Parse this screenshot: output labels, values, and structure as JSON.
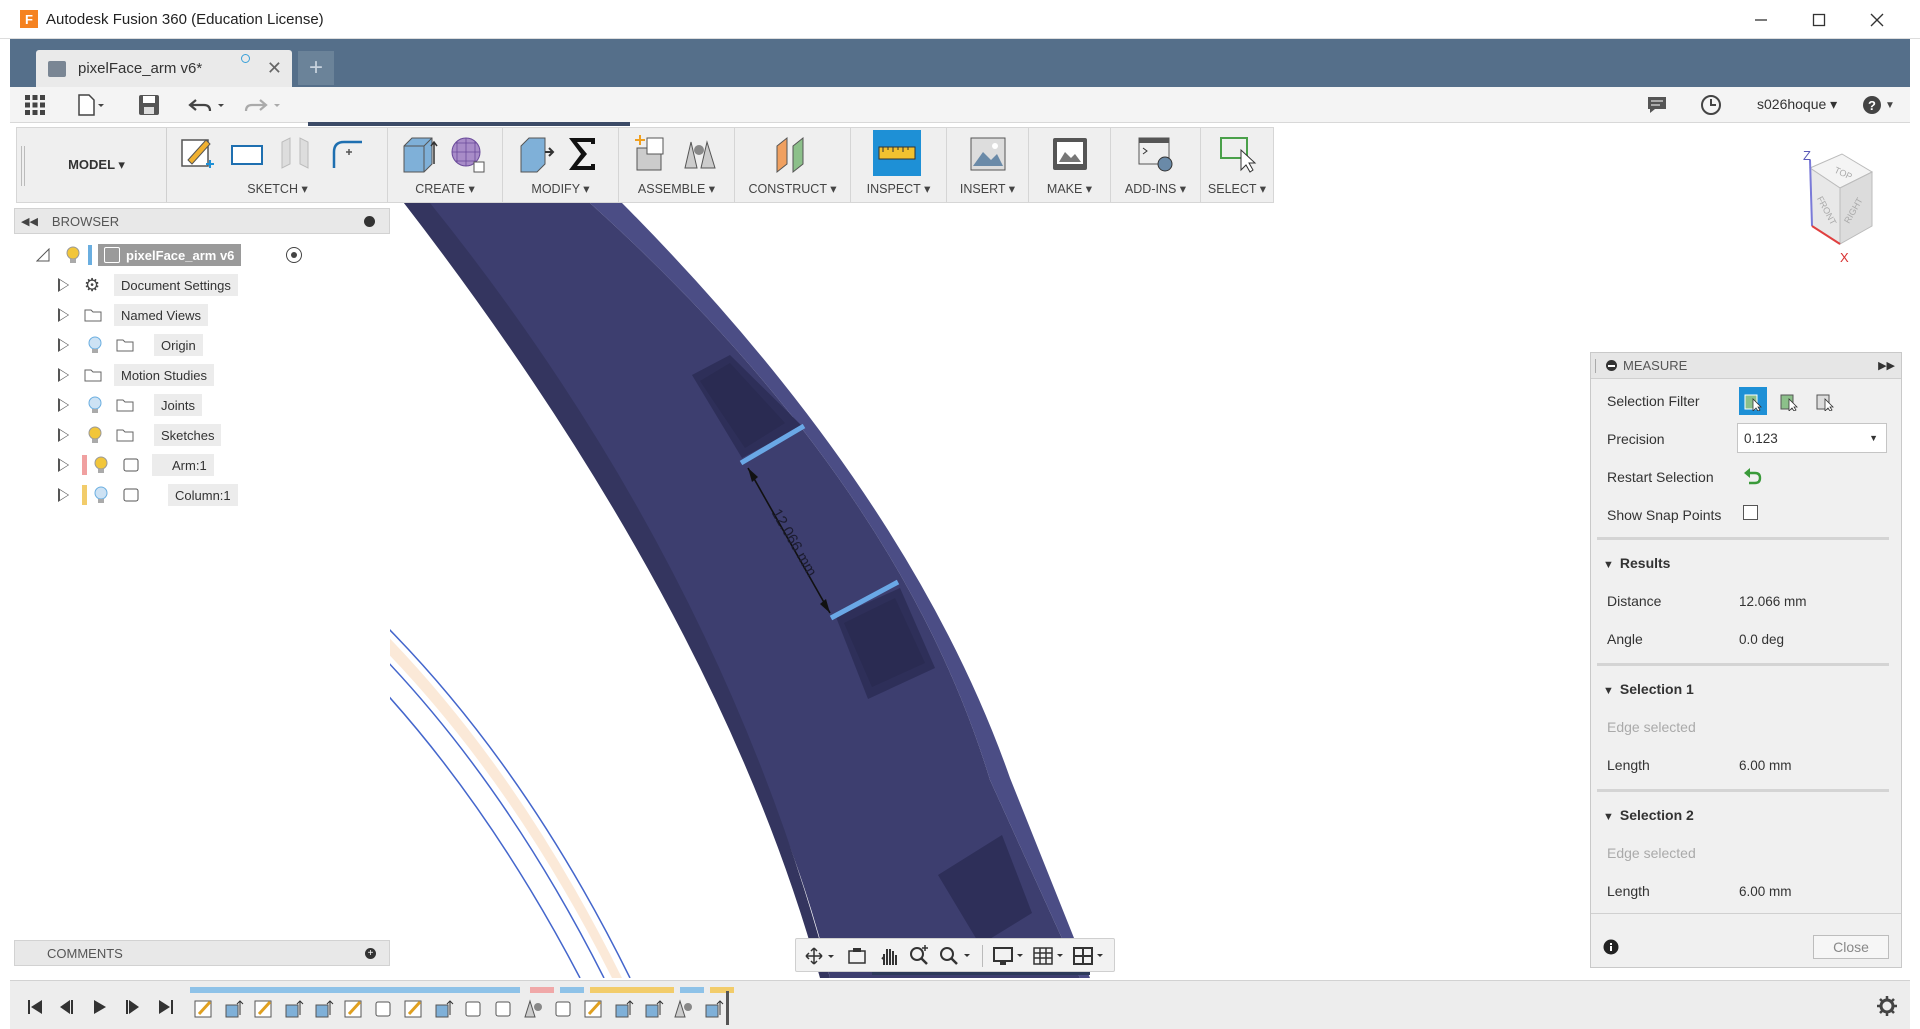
{
  "window": {
    "title": "Autodesk Fusion 360 (Education License)",
    "logo_letter": "F"
  },
  "tab": {
    "label": "pixelFace_arm v6*",
    "new_tab": "+"
  },
  "qat": {
    "user": "s026hoque ▾",
    "help": "? ▾"
  },
  "ribbon": {
    "workspace": "MODEL ▾",
    "groups": [
      "SKETCH ▾",
      "CREATE ▾",
      "MODIFY ▾",
      "ASSEMBLE ▾",
      "CONSTRUCT ▾",
      "INSPECT ▾",
      "INSERT ▾",
      "MAKE ▾",
      "ADD-INS ▾",
      "SELECT ▾"
    ]
  },
  "browser": {
    "header": "BROWSER",
    "root": "pixelFace_arm v6",
    "items": [
      {
        "label": "Document Settings"
      },
      {
        "label": "Named Views"
      },
      {
        "label": "Origin"
      },
      {
        "label": "Motion Studies"
      },
      {
        "label": "Joints"
      },
      {
        "label": "Sketches"
      },
      {
        "label": "Arm:1"
      },
      {
        "label": "Column:1"
      }
    ]
  },
  "viewcube": {
    "top": "TOP",
    "front": "FRONT",
    "right": "RIGHT",
    "axis_z": "Z",
    "axis_x": "X"
  },
  "viewport": {
    "dimension_label": "12.066 mm"
  },
  "measure": {
    "title": "MEASURE",
    "selection_filter_label": "Selection Filter",
    "precision_label": "Precision",
    "precision_value": "0.123",
    "restart_label": "Restart Selection",
    "snap_label": "Show Snap Points",
    "results_title": "Results",
    "distance_label": "Distance",
    "distance_value": "12.066 mm",
    "angle_label": "Angle",
    "angle_value": "0.0 deg",
    "sel1_title": "Selection 1",
    "sel1_status": "Edge selected",
    "sel1_length_label": "Length",
    "sel1_length_value": "6.00 mm",
    "sel2_title": "Selection 2",
    "sel2_status": "Edge selected",
    "sel2_length_label": "Length",
    "sel2_length_value": "6.00 mm",
    "close": "Close"
  },
  "comments": {
    "header": "COMMENTS"
  },
  "colors": {
    "model": "#3d3e6f",
    "model_dark": "#2e2f59",
    "model_light": "#4b4d85",
    "tab_strip": "#556f8a",
    "accent_blue": "#1e90d6",
    "edge_highlight": "#6aa8e6"
  }
}
